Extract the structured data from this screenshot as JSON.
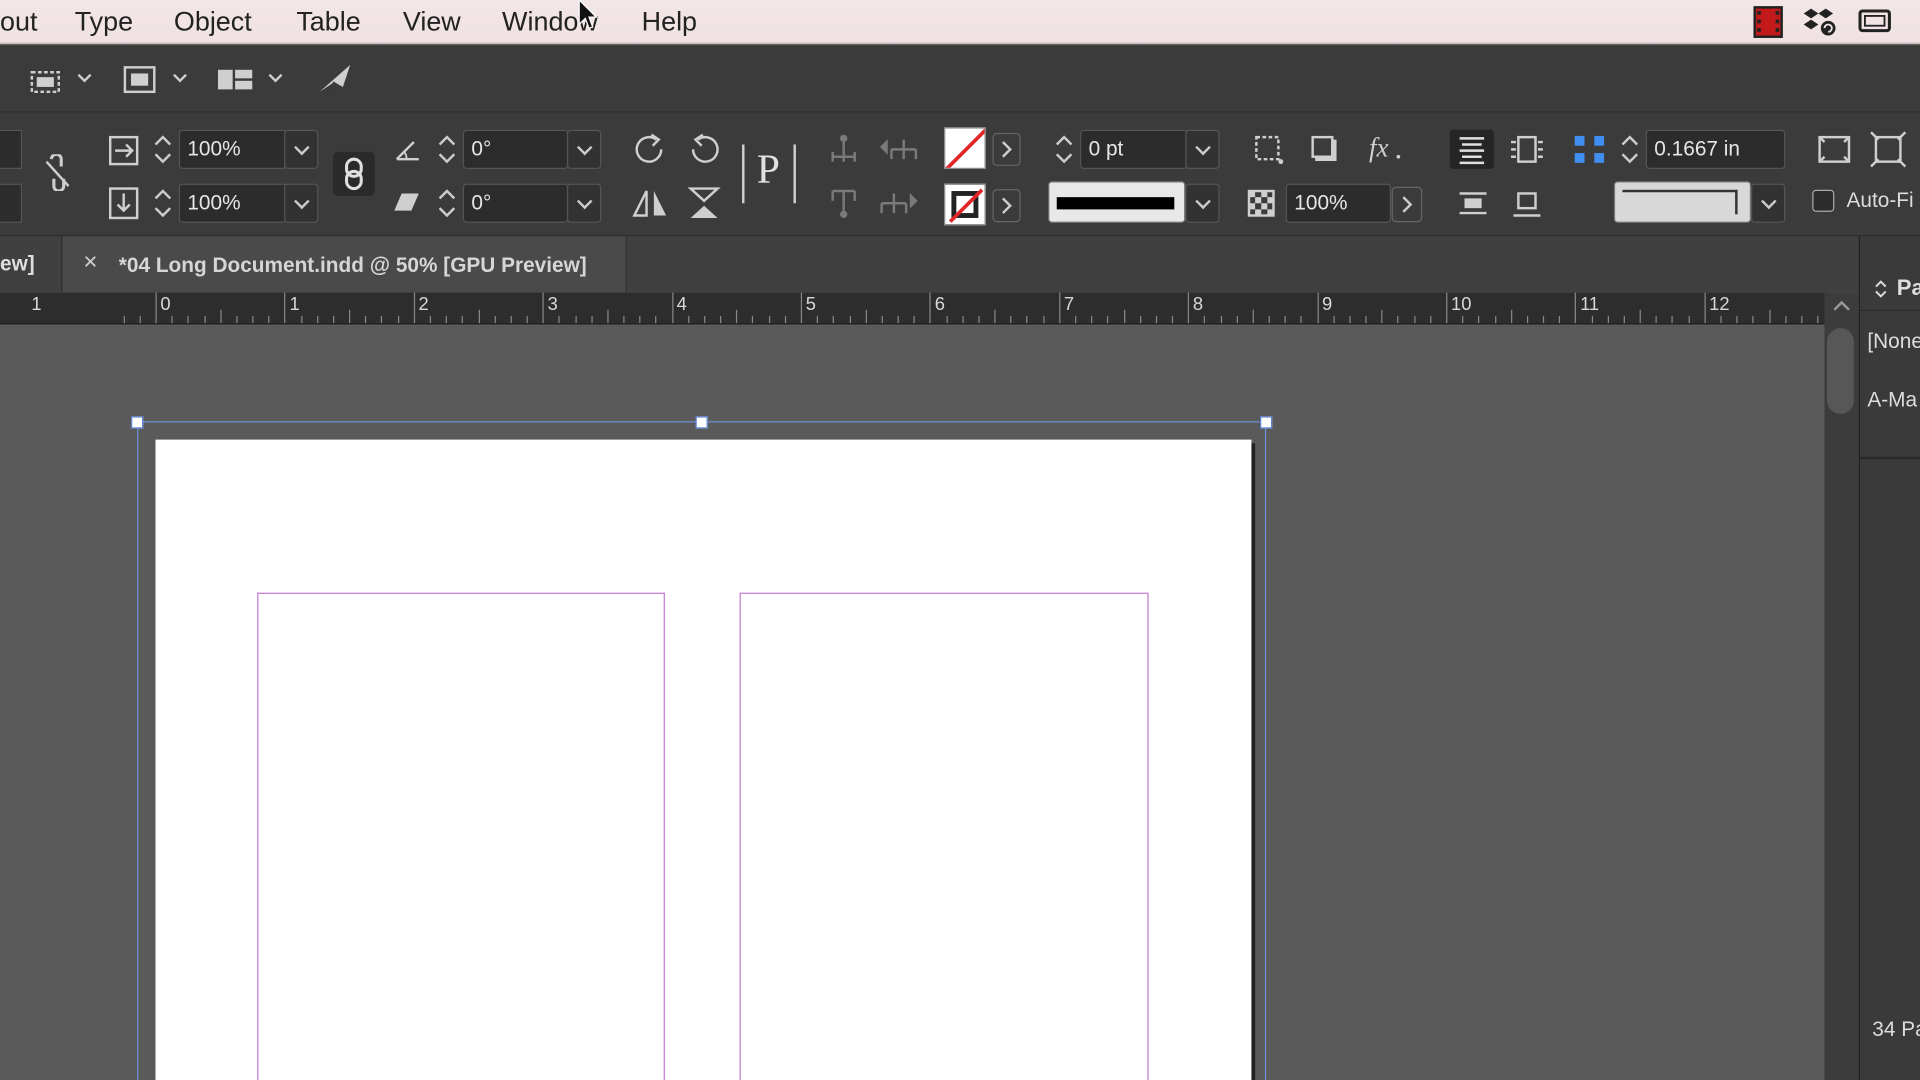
{
  "menubar": {
    "items": [
      "out",
      "Type",
      "Object",
      "Table",
      "View",
      "Window",
      "Help"
    ]
  },
  "control_panel": {
    "scale_x": "100%",
    "scale_y": "100%",
    "rotation": "0°",
    "shear": "0°",
    "stroke_weight": "0 pt",
    "opacity": "100%",
    "gap": "0.1667 in",
    "auto_fit_label": "Auto-Fi",
    "text_frame_glyph": "P"
  },
  "tabs": {
    "previous_tab_fragment": "ew]",
    "active_tab_title": "*04 Long Document.indd @ 50% [GPU Preview]",
    "close_glyph": "×"
  },
  "ruler": {
    "labels": [
      "1",
      "0",
      "1",
      "2",
      "3",
      "4",
      "5",
      "6",
      "7",
      "8",
      "9",
      "10",
      "11",
      "12"
    ]
  },
  "pages_panel": {
    "header": "Pa",
    "item_none": "[None",
    "item_master": "A-Ma",
    "footer": "34 Pa"
  },
  "colors": {
    "accent_selection": "#5a7fd2",
    "margin_guides": "#c07bd0",
    "no_fill_red": "#e0262a"
  }
}
